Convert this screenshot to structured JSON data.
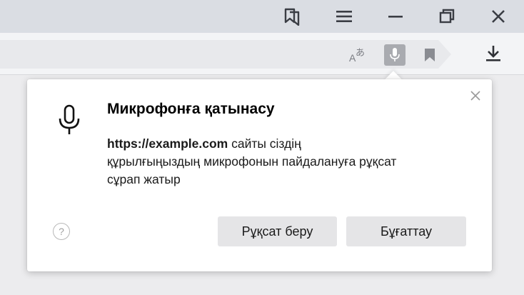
{
  "titlebar": {
    "icons": [
      "bookmarks-panel-icon",
      "menu-icon",
      "minimize-icon",
      "restore-icon",
      "close-icon"
    ]
  },
  "addressbar": {
    "icons": [
      "translate-icon",
      "microphone-icon",
      "bookmark-icon",
      "download-icon"
    ]
  },
  "popup": {
    "title": "Микрофонға қатынасу",
    "origin": "https://example.com",
    "message_part1": " сайты сіздің",
    "message_part2": "құрылғыңыздың микрофонын пайдалануға рұқсат",
    "message_part3": "сұрап жатыр",
    "help_glyph": "?",
    "allow_label": "Рұқсат беру",
    "block_label": "Бұғаттау"
  },
  "colors": {
    "titlebar": "#dadde3",
    "addressbar": "#f3f4f6",
    "omnibox": "#e8e9ec",
    "mic_active": "#a9abb0",
    "button_bg": "#e5e5e7"
  }
}
